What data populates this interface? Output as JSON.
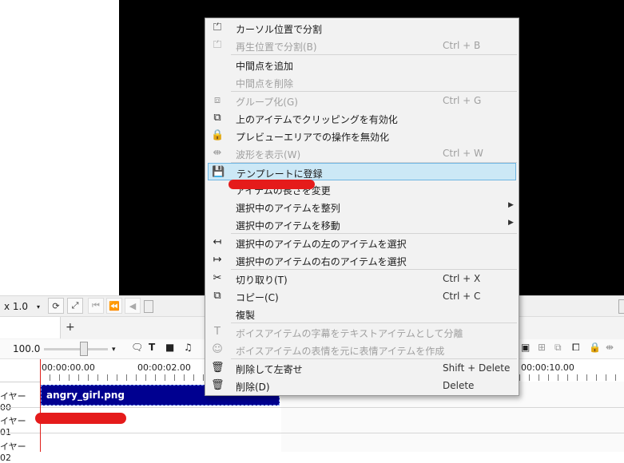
{
  "playbar": {
    "speed": "x 1.0"
  },
  "tabs": {
    "add_label": "+"
  },
  "timeline_toolbar": {
    "zoom_value": "100.0"
  },
  "ruler": {
    "labels": [
      "00:00:00.00",
      "00:00:02.00",
      "00:00:10.00"
    ]
  },
  "layers": [
    {
      "name": "イヤー 00"
    },
    {
      "name": "イヤー 01"
    },
    {
      "name": "イヤー 02"
    }
  ],
  "clip": {
    "name": "angry_girl.png"
  },
  "context_menu": {
    "items": [
      {
        "label": "カーソル位置で分割",
        "shortcut": "",
        "icon": "split-cursor-icon",
        "disabled": false
      },
      {
        "label": "再生位置で分割(B)",
        "shortcut": "Ctrl + B",
        "icon": "split-playhead-icon",
        "disabled": true
      },
      {
        "label": "中間点を追加",
        "shortcut": "",
        "icon": "",
        "disabled": false
      },
      {
        "label": "中間点を削除",
        "shortcut": "",
        "icon": "",
        "disabled": true
      },
      {
        "label": "グループ化(G)",
        "shortcut": "Ctrl + G",
        "icon": "group-icon",
        "disabled": true
      },
      {
        "label": "上のアイテムでクリッピングを有効化",
        "shortcut": "",
        "icon": "clipping-icon",
        "disabled": false
      },
      {
        "label": "プレビューエリアでの操作を無効化",
        "shortcut": "",
        "icon": "lock-icon",
        "disabled": false
      },
      {
        "label": "波形を表示(W)",
        "shortcut": "Ctrl + W",
        "icon": "waveform-icon",
        "disabled": true
      },
      {
        "label": "テンプレートに登録",
        "shortcut": "",
        "icon": "save-template-icon",
        "disabled": false,
        "highlighted": true
      },
      {
        "label": "アイテムの長さを変更",
        "shortcut": "",
        "icon": "",
        "disabled": false
      },
      {
        "label": "選択中のアイテムを整列",
        "shortcut": "",
        "icon": "",
        "disabled": false,
        "submenu": true
      },
      {
        "label": "選択中のアイテムを移動",
        "shortcut": "",
        "icon": "",
        "disabled": false,
        "submenu": true
      },
      {
        "label": "選択中のアイテムの左のアイテムを選択",
        "shortcut": "",
        "icon": "select-left-icon",
        "disabled": false
      },
      {
        "label": "選択中のアイテムの右のアイテムを選択",
        "shortcut": "",
        "icon": "select-right-icon",
        "disabled": false
      },
      {
        "label": "切り取り(T)",
        "shortcut": "Ctrl + X",
        "icon": "scissors-icon",
        "disabled": false
      },
      {
        "label": "コピー(C)",
        "shortcut": "Ctrl + C",
        "icon": "copy-icon",
        "disabled": false
      },
      {
        "label": "複製",
        "shortcut": "",
        "icon": "",
        "disabled": false
      },
      {
        "label": "ボイスアイテムの字幕をテキストアイテムとして分離",
        "shortcut": "",
        "icon": "text-icon",
        "disabled": true
      },
      {
        "label": "ボイスアイテムの表情を元に表情アイテムを作成",
        "shortcut": "",
        "icon": "face-icon",
        "disabled": true
      },
      {
        "label": "削除して左寄せ",
        "shortcut": "Shift + Delete",
        "icon": "delete-shift-icon",
        "disabled": false
      },
      {
        "label": "削除(D)",
        "shortcut": "Delete",
        "icon": "trash-icon",
        "disabled": false
      }
    ],
    "submenu_arrow": "▶"
  },
  "colors": {
    "clip_bg": "#000090",
    "highlight_bg": "#cce8f6",
    "highlight_border": "#6fb5e2",
    "annotation_red": "#e51b1b",
    "playhead": "#e0201a"
  }
}
